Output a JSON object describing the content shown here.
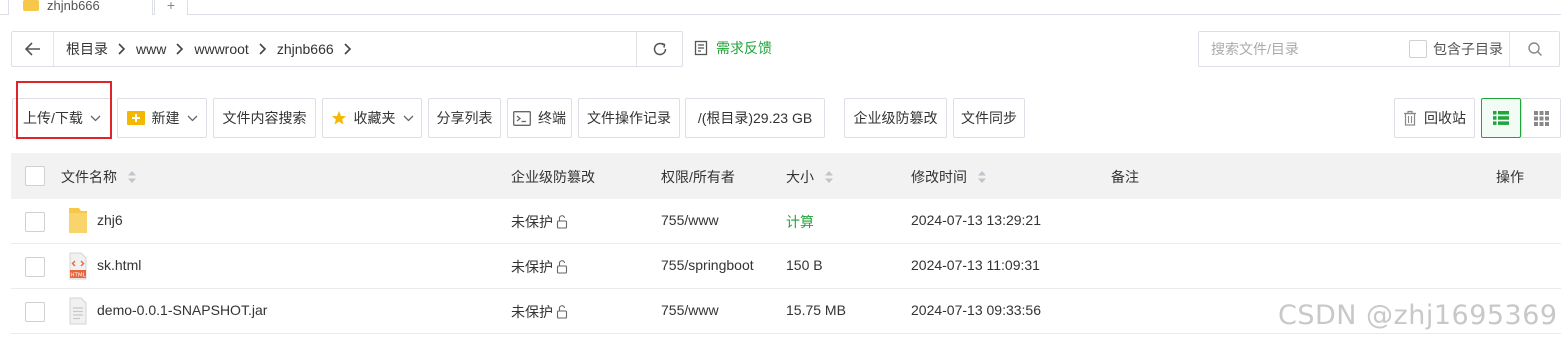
{
  "tabs": [
    {
      "label": "zhjnb666"
    }
  ],
  "address": {
    "crumbs": [
      "根目录",
      "www",
      "wwwroot",
      "zhjnb666"
    ]
  },
  "feedback_label": "需求反馈",
  "search": {
    "placeholder": "搜索文件/目录",
    "include_sub_label": "包含子目录"
  },
  "toolbar": {
    "upload_download": "上传/下载",
    "new": "新建",
    "content_search": "文件内容搜索",
    "favorites": "收藏夹",
    "share_list": "分享列表",
    "terminal": "终端",
    "op_log": "文件操作记录",
    "disk": "/(根目录)29.23 GB",
    "tamper": "企业级防篡改",
    "sync": "文件同步",
    "recycle": "回收站"
  },
  "table": {
    "headers": {
      "name": "文件名称",
      "tamper": "企业级防篡改",
      "perm": "权限/所有者",
      "size": "大小",
      "mtime": "修改时间",
      "note": "备注",
      "ops": "操作"
    },
    "rows": [
      {
        "name": "zhj6",
        "type": "folder",
        "tamper": "未保护",
        "perm": "755/www",
        "size": "计算",
        "mtime": "2024-07-13 13:29:21"
      },
      {
        "name": "sk.html",
        "type": "html",
        "tamper": "未保护",
        "perm": "755/springboot",
        "size": "150 B",
        "mtime": "2024-07-13 11:09:31"
      },
      {
        "name": "demo-0.0.1-SNAPSHOT.jar",
        "type": "file",
        "tamper": "未保护",
        "perm": "755/www",
        "size": "15.75 MB",
        "mtime": "2024-07-13 09:33:56"
      }
    ]
  },
  "watermark": "CSDN @zhj1695369",
  "colors": {
    "accent": "#20a53a",
    "highlight": "#e0242b",
    "header_bg": "#f2f2f2"
  }
}
